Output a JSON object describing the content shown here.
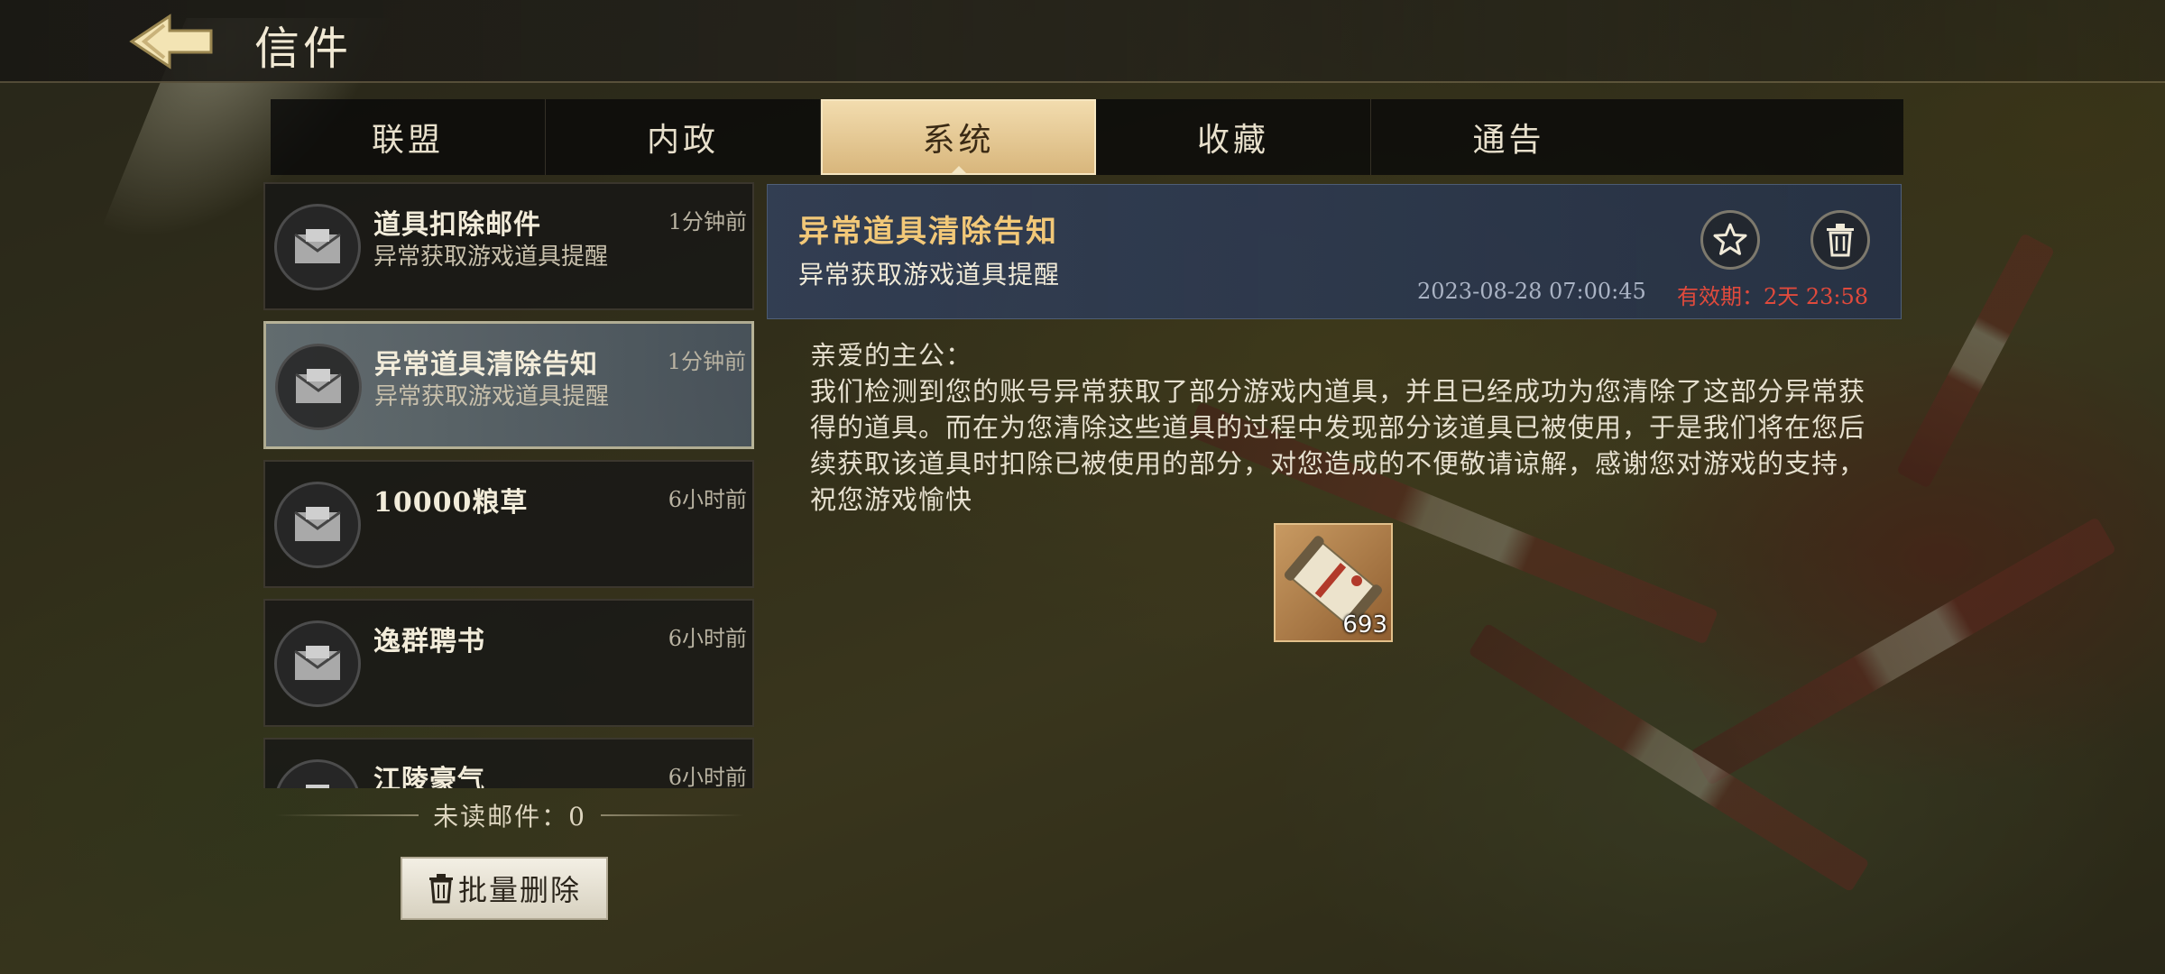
{
  "header": {
    "title": "信件"
  },
  "tabs": [
    {
      "label": "联盟"
    },
    {
      "label": "内政"
    },
    {
      "label": "系统"
    },
    {
      "label": "收藏"
    },
    {
      "label": "通告"
    }
  ],
  "active_tab": "系统",
  "mail_list": [
    {
      "title": "道具扣除邮件",
      "subtitle": "异常获取游戏道具提醒",
      "time": "1分钟前"
    },
    {
      "title": "异常道具清除告知",
      "subtitle": "异常获取游戏道具提醒",
      "time": "1分钟前"
    },
    {
      "title": "10000粮草",
      "subtitle": "",
      "time": "6小时前"
    },
    {
      "title": "逸群聘书",
      "subtitle": "",
      "time": "6小时前"
    },
    {
      "title": "江陵豪气",
      "subtitle": "",
      "time": "6小时前"
    }
  ],
  "unread": {
    "text": "未读邮件：0"
  },
  "batch_delete": {
    "label": "批量删除"
  },
  "detail": {
    "title": "异常道具清除告知",
    "subtitle": "异常获取游戏道具提醒",
    "datetime": "2023-08-28  07:00:45",
    "expiry": "有效期：2天  23:58",
    "greeting": "亲爱的主公：",
    "body": "我们检测到您的账号异常获取了部分游戏内道具，并且已经成功为您清除了这部分异常获得的道具。而在为您清除这些道具的过程中发现部分该道具已被使用，于是我们将在您后续获取该道具时扣除已被使用的部分，对您造成的不便敬请谅解，感谢您对游戏的支持，祝您游戏愉快",
    "reward": {
      "icon": "scroll-icon",
      "count": "693"
    }
  },
  "colors": {
    "accent_gold": "#f2c878",
    "expiry_red": "#e04a3c",
    "tab_active": "#e6c890"
  }
}
